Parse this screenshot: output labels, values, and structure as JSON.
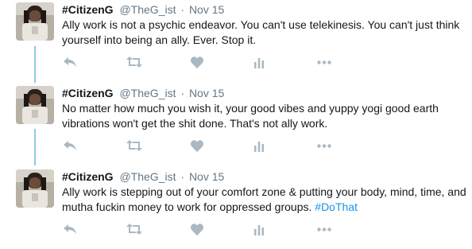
{
  "colors": {
    "text": "#14171a",
    "muted": "#657786",
    "link": "#1b95e0",
    "icon": "#aab8c2",
    "thread_line": "#8fc7e8"
  },
  "tweets": [
    {
      "name": "#CitizenG",
      "handle": "@TheG_ist",
      "separator": "·",
      "date": "Nov 15",
      "text": "Ally work is not a psychic endeavor. You can't use telekinesis. You can't just think yourself into being an ally. Ever. Stop it.",
      "hashtag": ""
    },
    {
      "name": "#CitizenG",
      "handle": "@TheG_ist",
      "separator": "·",
      "date": "Nov 15",
      "text": "No matter how much you wish it, your good vibes and yuppy yogi good earth vibrations won't get the shit done. That's not ally work.",
      "hashtag": ""
    },
    {
      "name": "#CitizenG",
      "handle": "@TheG_ist",
      "separator": "·",
      "date": "Nov 15",
      "text": "Ally work is stepping out of your comfort zone & putting your body, mind, time, and mutha fuckin money to work for oppressed groups. ",
      "hashtag": "#DoThat"
    }
  ],
  "icons": [
    "reply-icon",
    "retweet-icon",
    "like-icon",
    "analytics-icon",
    "more-icon"
  ]
}
